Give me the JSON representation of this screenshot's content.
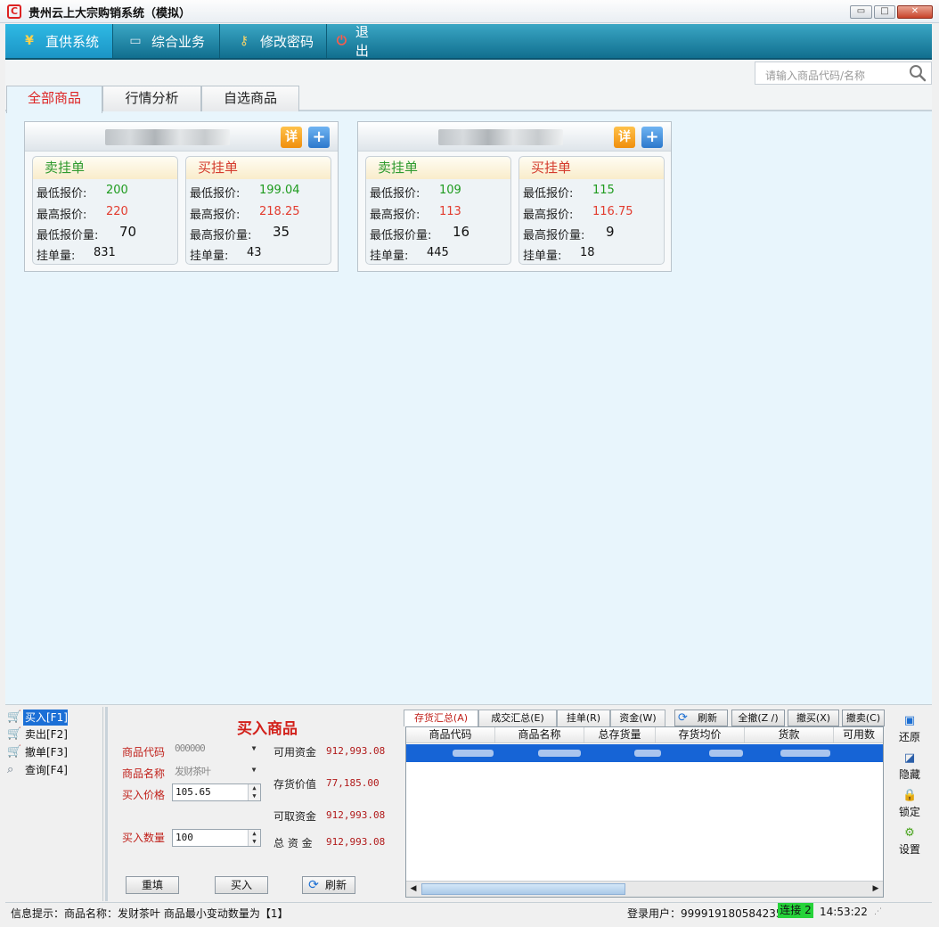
{
  "window": {
    "title": "贵州云上大宗购销系统（模拟）",
    "min_glyph": "▭",
    "max_glyph": "□",
    "close_glyph": "✕"
  },
  "nav": {
    "items": [
      {
        "label": "直供系统",
        "icon": "yen-icon",
        "glyph": "¥"
      },
      {
        "label": "综合业务",
        "icon": "monitor-icon",
        "glyph": "▭"
      },
      {
        "label": "修改密码",
        "icon": "key-icon",
        "glyph": "⚷"
      },
      {
        "label": "退 出",
        "icon": "power-icon",
        "glyph": "⏻"
      }
    ]
  },
  "search": {
    "placeholder": "请输入商品代码/名称"
  },
  "tabs": [
    "全部商品",
    "行情分析",
    "自选商品"
  ],
  "card_buttons": {
    "detail": "详",
    "add": "+"
  },
  "cards": [
    {
      "sell": {
        "title": "卖挂单",
        "low_label": "最低报价:",
        "low": "200",
        "high_label": "最高报价:",
        "high": "220",
        "lowqty_label": "最低报价量:",
        "lowqty": "70",
        "count_label": "挂单量:",
        "count": "831"
      },
      "buy": {
        "title": "买挂单",
        "low_label": "最低报价:",
        "low": "199.04",
        "high_label": "最高报价:",
        "high": "218.25",
        "lowqty_label": "最高报价量:",
        "lowqty": "35",
        "count_label": "挂单量:",
        "count": "43"
      }
    },
    {
      "sell": {
        "title": "卖挂单",
        "low_label": "最低报价:",
        "low": "109",
        "high_label": "最高报价:",
        "high": "113",
        "lowqty_label": "最低报价量:",
        "lowqty": "16",
        "count_label": "挂单量:",
        "count": "445"
      },
      "buy": {
        "title": "买挂单",
        "low_label": "最低报价:",
        "low": "115",
        "high_label": "最高报价:",
        "high": "116.75",
        "lowqty_label": "最高报价量:",
        "lowqty": "9",
        "count_label": "挂单量:",
        "count": "18"
      }
    }
  ],
  "leftnav": [
    {
      "label": "买入[F1]",
      "icon": "cart-buy-icon"
    },
    {
      "label": "卖出[F2]",
      "icon": "cart-sell-icon"
    },
    {
      "label": "撤单[F3]",
      "icon": "cart-cancel-icon"
    },
    {
      "label": "查询[F4]",
      "icon": "magnifier-icon"
    }
  ],
  "buyform": {
    "title": "买入商品",
    "code_label": "商品代码",
    "code_value": "000000",
    "name_label": "商品名称",
    "name_value": "发财茶叶",
    "price_label": "买入价格",
    "price_value": "105.65",
    "qty_label": "买入数量",
    "qty_value": "100",
    "reset": "重填",
    "buy": "买入",
    "refresh": "刷新",
    "stats": [
      {
        "label": "可用资金",
        "value": "912,993.08"
      },
      {
        "label": "存货价值",
        "value": "77,185.00"
      },
      {
        "label": "可取资金",
        "value": "912,993.08"
      },
      {
        "label": "总 资 金",
        "value": "912,993.08"
      }
    ]
  },
  "holdings": {
    "tabs": [
      "存货汇总(A)",
      "成交汇总(E)",
      "挂单(R)",
      "资金(W)"
    ],
    "buttons": [
      "刷新",
      "全撤(Z /)",
      "撤买(X)",
      "撤卖(C)"
    ],
    "columns": [
      "商品代码",
      "商品名称",
      "总存货量",
      "存货均价",
      "货款",
      "可用数"
    ]
  },
  "right_tools": [
    {
      "label": "还原",
      "icon": "restore-icon"
    },
    {
      "label": "隐藏",
      "icon": "hide-icon"
    },
    {
      "label": "锁定",
      "icon": "lock-icon"
    },
    {
      "label": "设置",
      "icon": "gear-icon"
    }
  ],
  "status": {
    "info": "信息提示：商品名称：发财茶叶    商品最小变动数量为【1】",
    "user": "登录用户：999919180584235",
    "connection": "连接 2",
    "time": "14:53:22"
  }
}
